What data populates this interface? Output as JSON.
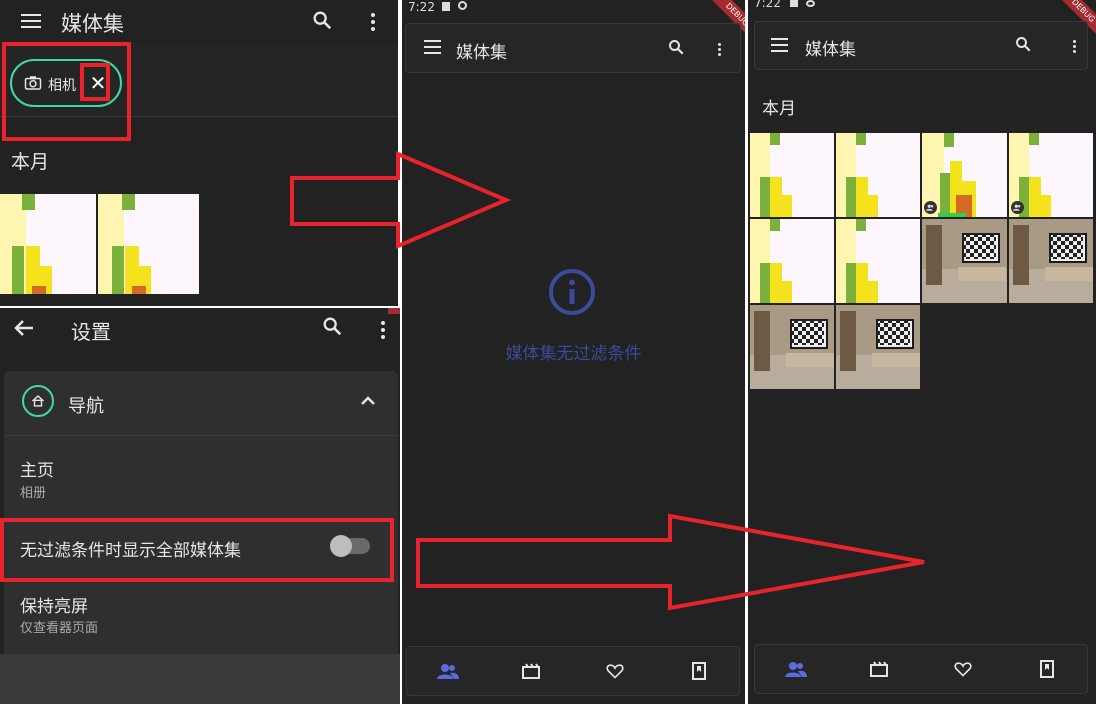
{
  "left_top": {
    "title": "媒体集",
    "chip_label": "相机",
    "section_header": "本月"
  },
  "settings": {
    "title": "设置",
    "group_title": "导航",
    "home_title": "主页",
    "home_subtitle": "相册",
    "toggle_label": "无过滤条件时显示全部媒体集",
    "toggle_on": false,
    "keep_screen_title": "保持亮屏",
    "keep_screen_subtitle": "仅查看器页面"
  },
  "middle": {
    "status_time": "7:22",
    "title": "媒体集",
    "empty_message": "媒体集无过滤条件",
    "debug_label": "DEBUG",
    "nav_icons": [
      "albums-icon",
      "video-icon",
      "favourite-icon",
      "bookmark-icon"
    ]
  },
  "right": {
    "status_time": "7:22",
    "title": "媒体集",
    "section_header": "本月",
    "debug_label": "DEBUG",
    "nav_icons": [
      "albums-icon",
      "video-icon",
      "favourite-icon",
      "bookmark-icon"
    ]
  },
  "colors": {
    "background": "#222222",
    "accent_teal": "#3ddca4",
    "accent_blue": "#5b6be0",
    "highlight_red": "#e8232b"
  }
}
